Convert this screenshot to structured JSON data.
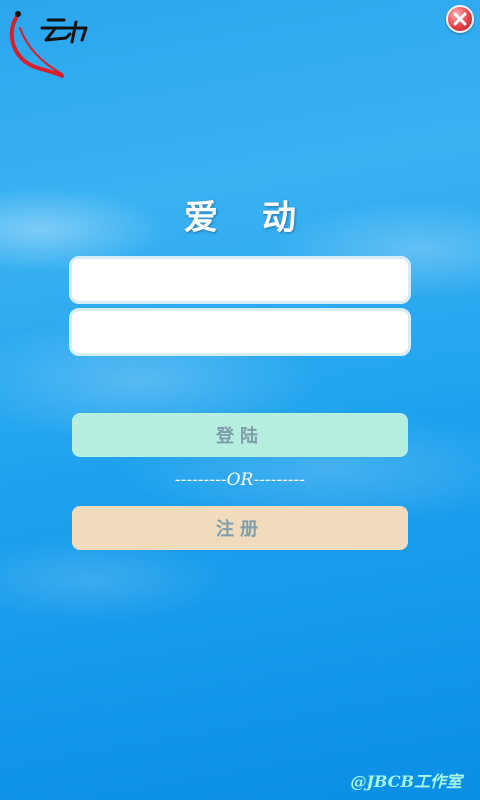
{
  "app": {
    "title_char_1": "爱",
    "title_char_2": "动"
  },
  "logo": {
    "icon": "app-logo-icon",
    "colors": {
      "heart": "#d81f2a",
      "mark": "#111111"
    }
  },
  "close": {
    "icon": "close-icon"
  },
  "form": {
    "username_value": "",
    "password_value": ""
  },
  "buttons": {
    "login_label": "登陆",
    "register_label": "注册"
  },
  "separator": {
    "text": "---------OR---------"
  },
  "footer": {
    "watermark": "@JBCB工作室"
  },
  "colors": {
    "login_bg": "#b6eedf",
    "register_bg": "#f0dcbd",
    "button_text": "#7f9caa",
    "watermark": "#a6f7e2"
  }
}
